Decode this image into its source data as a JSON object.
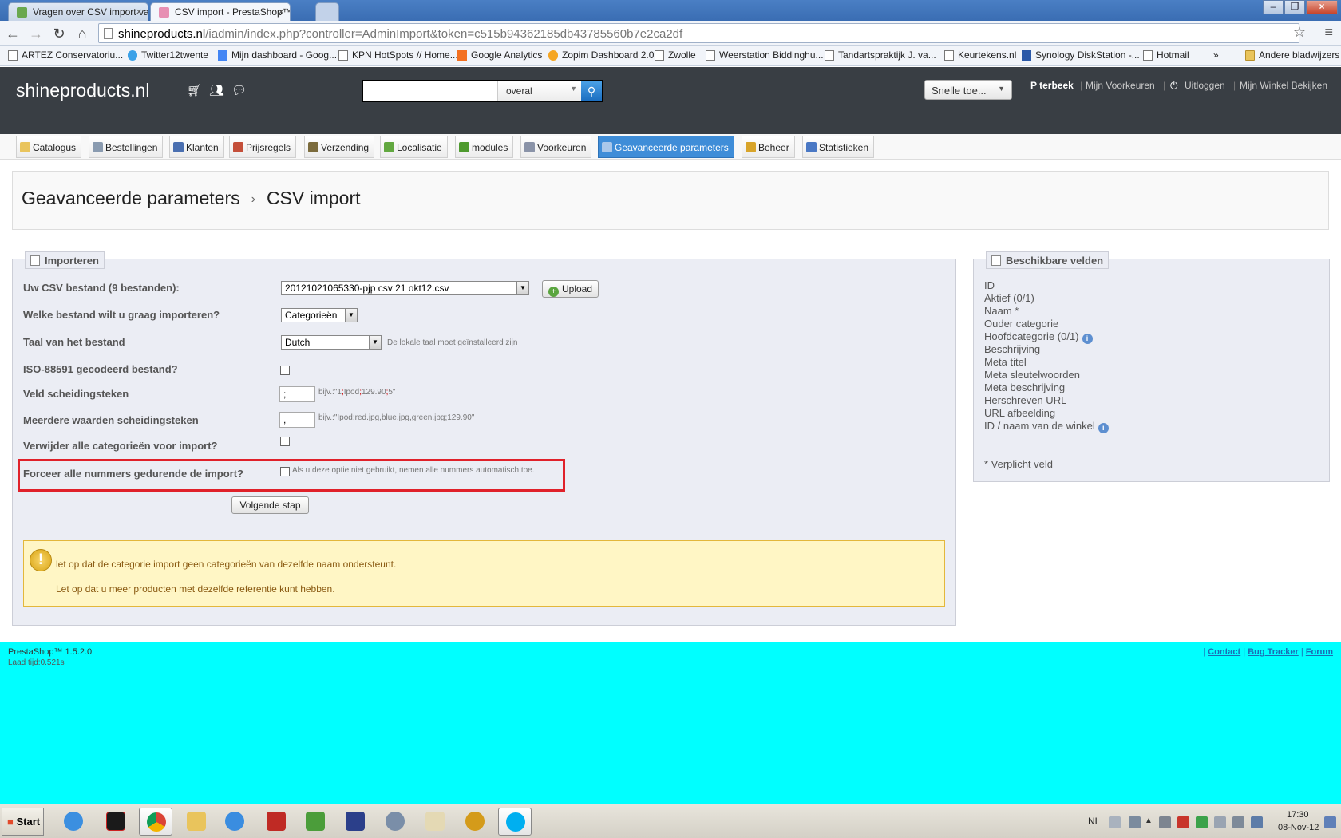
{
  "browser": {
    "tabs": [
      {
        "title": "Vragen over CSV import van o"
      },
      {
        "title": "CSV import - PrestaShop™"
      }
    ],
    "url_host": "shineproducts.nl",
    "url_rest": "/iadmin/index.php?controller=AdminImport&token=c515b94362185db43785560b7e2ca2df",
    "bookmarks": [
      "ARTEZ Conservatoriu...",
      "Twitter12twente",
      "Mijn dashboard - Goog...",
      "KPN HotSpots // Home...",
      "Google Analytics",
      "Zopim Dashboard 2.0",
      "Zwolle",
      "Weerstation Biddinghu...",
      "Tandartspraktijk J. va...",
      "Keurtekens.nl",
      "Synology DiskStation -...",
      "Hotmail"
    ],
    "bookmarks_overflow": "»",
    "other_bookmarks": "Andere bladwijzers"
  },
  "header": {
    "shop_name": "shineproducts.nl",
    "search_scope": "overal",
    "quick_access": "Snelle toe...",
    "user": "P terbeek",
    "links": [
      "Mijn Voorkeuren",
      "Uitloggen",
      "Mijn Winkel Bekijken"
    ]
  },
  "menu": [
    {
      "label": "Catalogus",
      "color": "#e9c45c"
    },
    {
      "label": "Bestellingen",
      "color": "#8a9bb0"
    },
    {
      "label": "Klanten",
      "color": "#4a6fb0"
    },
    {
      "label": "Prijsregels",
      "color": "#c44f3a"
    },
    {
      "label": "Verzending",
      "color": "#7b6b3c"
    },
    {
      "label": "Localisatie",
      "color": "#62a840"
    },
    {
      "label": "modules",
      "color": "#4e9a2e"
    },
    {
      "label": "Voorkeuren",
      "color": "#8a93a8"
    },
    {
      "label": "Geavanceerde parameters",
      "color": "#a9c7ea"
    },
    {
      "label": "Beheer",
      "color": "#d8a42a"
    },
    {
      "label": "Statistieken",
      "color": "#4a78c4"
    }
  ],
  "breadcrumb": {
    "parent": "Geavanceerde parameters",
    "separator": "›",
    "current": "CSV import"
  },
  "import": {
    "legend": "Importeren",
    "fields": {
      "csv_file": {
        "label": "Uw CSV bestand (9 bestanden):",
        "value": "20121021065330-pjp csv 21 okt12.csv",
        "upload": "Upload"
      },
      "entity": {
        "label": "Welke bestand wilt u graag importeren?",
        "value": "Categorieën"
      },
      "language": {
        "label": "Taal van het bestand",
        "value": "Dutch",
        "hint": "De lokale taal moet geïnstalleerd zijn"
      },
      "iso": {
        "label": "ISO-88591 gecodeerd bestand?"
      },
      "separator": {
        "label": "Veld scheidingsteken",
        "value": ";",
        "hint_pre": "bijv.:\"1",
        "hint_s1": ";",
        "hint_mid1": "Ipod",
        "hint_s2": ";",
        "hint_mid2": "129.90",
        "hint_s3": ";",
        "hint_post": "5\""
      },
      "multi_separator": {
        "label": "Meerdere waarden scheidingsteken",
        "value": ",",
        "hint": "bijv.:\"Ipod;red.jpg,blue.jpg,green.jpg;129.90\""
      },
      "truncate": {
        "label": "Verwijder alle categorieën voor import?"
      },
      "force_ids": {
        "label": "Forceer alle nummers gedurende de import?",
        "hint": "Als u deze optie niet gebruikt, nemen alle nummers automatisch toe."
      }
    },
    "next_button": "Volgende stap",
    "alerts": [
      "let op dat de categorie import geen categorieën van dezelfde naam ondersteunt.",
      "Let op dat u meer producten met dezelfde referentie kunt hebben."
    ]
  },
  "available_fields": {
    "legend": "Beschikbare velden",
    "items": [
      "ID",
      "Aktief (0/1)",
      "Naam *",
      "Ouder categorie",
      "Hoofdcategorie (0/1)",
      "Beschrijving",
      "Meta titel",
      "Meta sleutelwoorden",
      "Meta beschrijving",
      "Herschreven URL",
      "URL afbeelding",
      "ID / naam van de winkel"
    ],
    "required_note": "* Verplicht veld"
  },
  "footer": {
    "version": "PrestaShop™ 1.5.2.0",
    "load_time": "Laad tijd:0.521s",
    "links": [
      "Contact",
      "Bug Tracker",
      "Forum"
    ]
  },
  "taskbar": {
    "start": "Start",
    "language": "NL",
    "time": "17:30",
    "date": "08-Nov-12"
  },
  "colors": {
    "header_bg": "#393e44",
    "menu_active": "#3f8dd8",
    "footer_bg": "#00ffff",
    "highlight": "#e0212a",
    "alert_bg": "#fff6c5"
  }
}
